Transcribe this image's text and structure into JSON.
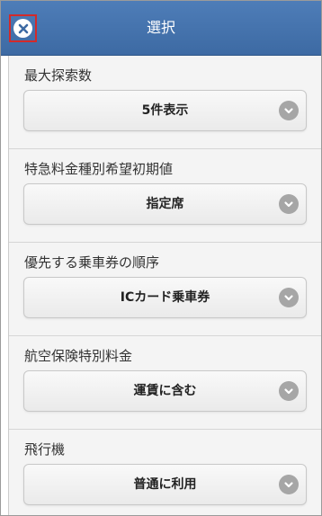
{
  "header": {
    "title": "選択",
    "close_icon": "close-icon"
  },
  "sections": [
    {
      "label": "最大探索数",
      "value": "5件表示"
    },
    {
      "label": "特急料金種別希望初期値",
      "value": "指定席"
    },
    {
      "label": "優先する乗車券の順序",
      "value": "ICカード乗車券"
    },
    {
      "label": "航空保険特別料金",
      "value": "運賃に含む"
    },
    {
      "label": "飛行機",
      "value": "普通に利用"
    }
  ],
  "colors": {
    "header": "#4672ad",
    "highlight": "#d32a2a",
    "chevron": "#a6a6a6"
  }
}
